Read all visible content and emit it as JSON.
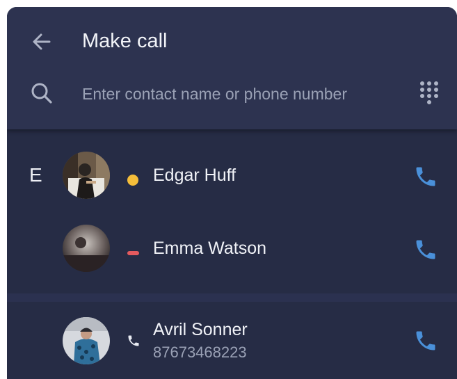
{
  "header": {
    "title": "Make call",
    "back_icon": "arrow-left-icon",
    "search_icon": "search-icon",
    "dialpad_icon": "dialpad-icon"
  },
  "search": {
    "placeholder": "Enter contact name or phone number",
    "value": ""
  },
  "groups": [
    {
      "letter": "E",
      "contacts": [
        {
          "name": "Edgar Huff",
          "status": "away",
          "status_color": "#f5be3a"
        },
        {
          "name": "Emma Watson",
          "status": "do-not-disturb",
          "status_color": "#e45a5e"
        }
      ]
    },
    {
      "letter": "",
      "contacts": [
        {
          "name": "Avril Sonner",
          "number": "87673468223",
          "status": "phone"
        }
      ]
    }
  ],
  "colors": {
    "background": "#262c45",
    "header": "#2d3350",
    "accent_call": "#4a90d9",
    "text": "#f0f2f7",
    "muted": "#9aa1b5"
  }
}
